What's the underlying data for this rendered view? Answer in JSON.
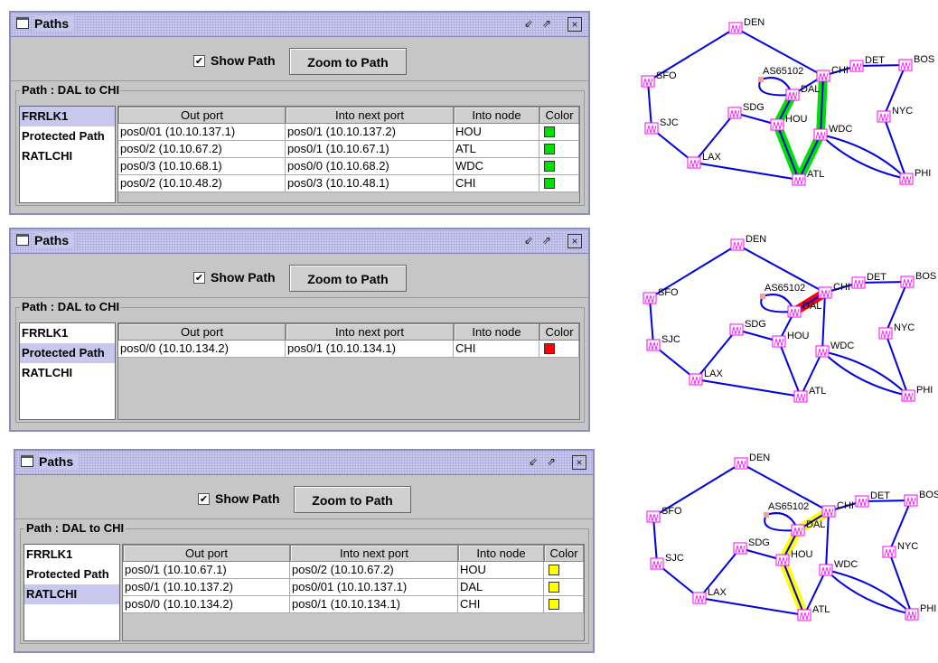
{
  "columns": [
    "Out port",
    "Into next port",
    "Into node",
    "Color"
  ],
  "list_items": [
    "FRRLK1",
    "Protected Path",
    "RATLCHI"
  ],
  "windows": [
    {
      "title": "Paths",
      "show_path_label": "Show Path",
      "show_path_checked": true,
      "zoom_button": "Zoom to Path",
      "group_title": "Path : DAL to CHI",
      "selected_index": 0,
      "path_color": "#00e000",
      "rows": [
        [
          "pos0/01 (10.10.137.1)",
          "pos0/1 (10.10.137.2)",
          "HOU"
        ],
        [
          "pos0/2 (10.10.67.2)",
          "pos0/1 (10.10.67.1)",
          "ATL"
        ],
        [
          "pos0/3 (10.10.68.1)",
          "pos0/0 (10.10.68.2)",
          "WDC"
        ],
        [
          "pos0/2 (10.10.48.2)",
          "pos0/3 (10.10.48.1)",
          "CHI"
        ]
      ],
      "highlight_path": [
        "DAL",
        "HOU",
        "ATL",
        "WDC",
        "CHI"
      ]
    },
    {
      "title": "Paths",
      "show_path_label": "Show Path",
      "show_path_checked": true,
      "zoom_button": "Zoom to Path",
      "group_title": "Path : DAL to CHI",
      "selected_index": 1,
      "path_color": "#ff0000",
      "rows": [
        [
          "pos0/0 (10.10.134.2)",
          "pos0/1 (10.10.134.1)",
          "CHI"
        ]
      ],
      "highlight_path": [
        "DAL",
        "CHI"
      ]
    },
    {
      "title": "Paths",
      "show_path_label": "Show Path",
      "show_path_checked": true,
      "zoom_button": "Zoom to Path",
      "group_title": "Path : DAL to CHI",
      "selected_index": 2,
      "path_color": "#ffff00",
      "rows": [
        [
          "pos0/1 (10.10.67.1)",
          "pos0/2 (10.10.67.2)",
          "HOU"
        ],
        [
          "pos0/1 (10.10.137.2)",
          "pos0/01 (10.10.137.1)",
          "DAL"
        ],
        [
          "pos0/0 (10.10.134.2)",
          "pos0/1 (10.10.134.1)",
          "CHI"
        ]
      ],
      "highlight_path": [
        "ATL",
        "HOU",
        "DAL",
        "CHI"
      ]
    }
  ],
  "topology": {
    "nodes": [
      "DEN",
      "SFO",
      "SJC",
      "LAX",
      "SDG",
      "HOU",
      "DAL",
      "AS65102",
      "CHI",
      "DET",
      "BOS",
      "NYC",
      "WDC",
      "ATL",
      "PHI"
    ],
    "links": [
      [
        "DEN",
        "SFO"
      ],
      [
        "DEN",
        "CHI"
      ],
      [
        "SFO",
        "SJC"
      ],
      [
        "SJC",
        "LAX"
      ],
      [
        "LAX",
        "SDG"
      ],
      [
        "SDG",
        "HOU"
      ],
      [
        "LAX",
        "ATL"
      ],
      [
        "HOU",
        "DAL"
      ],
      [
        "DAL",
        "AS65102"
      ],
      [
        "DAL",
        "CHI"
      ],
      [
        "CHI",
        "DET"
      ],
      [
        "DET",
        "BOS"
      ],
      [
        "BOS",
        "NYC"
      ],
      [
        "NYC",
        "PHI"
      ],
      [
        "WDC",
        "PHI"
      ],
      [
        "CHI",
        "WDC"
      ],
      [
        "WDC",
        "ATL"
      ],
      [
        "HOU",
        "ATL"
      ]
    ],
    "link_color": "#0000e0",
    "node_color": "#ff00ff"
  }
}
